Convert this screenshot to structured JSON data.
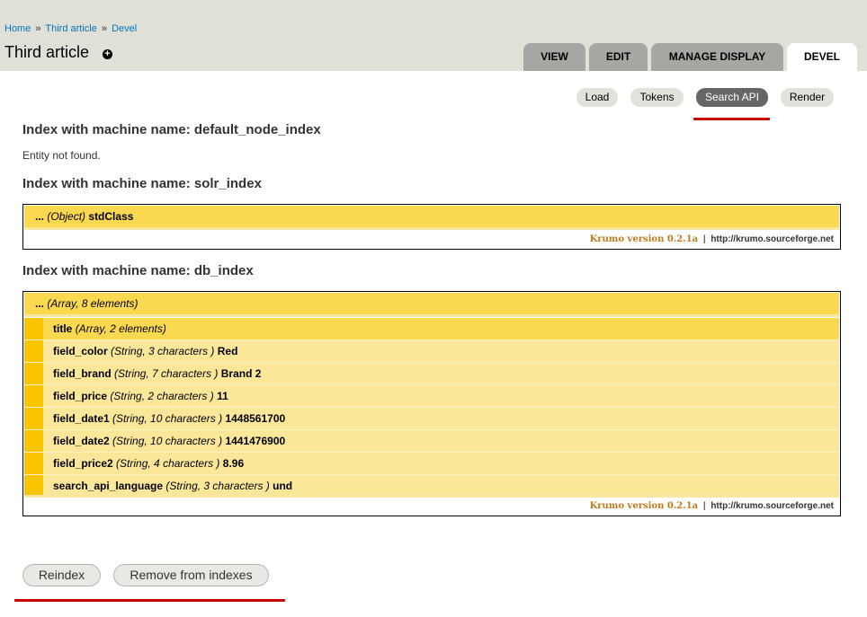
{
  "breadcrumb": {
    "home": "Home",
    "sep1": "»",
    "article": "Third article",
    "sep2": "»",
    "devel": "Devel"
  },
  "page": {
    "title": "Third article",
    "title_icon": "plus-icon"
  },
  "tabs": [
    {
      "label": "VIEW",
      "active": false
    },
    {
      "label": "EDIT",
      "active": false
    },
    {
      "label": "MANAGE DISPLAY",
      "active": false
    },
    {
      "label": "DEVEL",
      "active": true
    }
  ],
  "subtabs": [
    {
      "label": "Load",
      "active": false
    },
    {
      "label": "Tokens",
      "active": false
    },
    {
      "label": "Search API",
      "active": true
    },
    {
      "label": "Render",
      "active": false
    }
  ],
  "index1": {
    "heading": "Index with machine name: default_node_index",
    "message": "Entity not found."
  },
  "index2": {
    "heading": "Index with machine name: solr_index",
    "root": {
      "prefix": "...",
      "type": "(Object)",
      "value": "stdClass"
    }
  },
  "index3": {
    "heading": "Index with machine name: db_index",
    "root": {
      "prefix": "...",
      "type": "(Array, 8 elements)"
    },
    "items": [
      {
        "key": "title",
        "type": "(Array, 2 elements)",
        "value": ""
      },
      {
        "key": "field_color",
        "type": "(String, 3 characters )",
        "value": "Red"
      },
      {
        "key": "field_brand",
        "type": "(String, 7 characters )",
        "value": "Brand 2"
      },
      {
        "key": "field_price",
        "type": "(String, 2 characters )",
        "value": "11"
      },
      {
        "key": "field_date1",
        "type": "(String, 10 characters )",
        "value": "1448561700"
      },
      {
        "key": "field_date2",
        "type": "(String, 10 characters )",
        "value": "1441476900"
      },
      {
        "key": "field_price2",
        "type": "(String, 4 characters )",
        "value": "8.96"
      },
      {
        "key": "search_api_language",
        "type": "(String, 3 characters )",
        "value": "und"
      }
    ]
  },
  "krumo": {
    "version": "Krumo version 0.2.1a",
    "pipe": "|",
    "url": "http://krumo.sourceforge.net"
  },
  "buttons": {
    "reindex": "Reindex",
    "remove": "Remove from indexes"
  },
  "colors": {
    "accent_underline": "#c80000",
    "link": "#0074bd",
    "krumo_yellow": "#fad84f"
  }
}
